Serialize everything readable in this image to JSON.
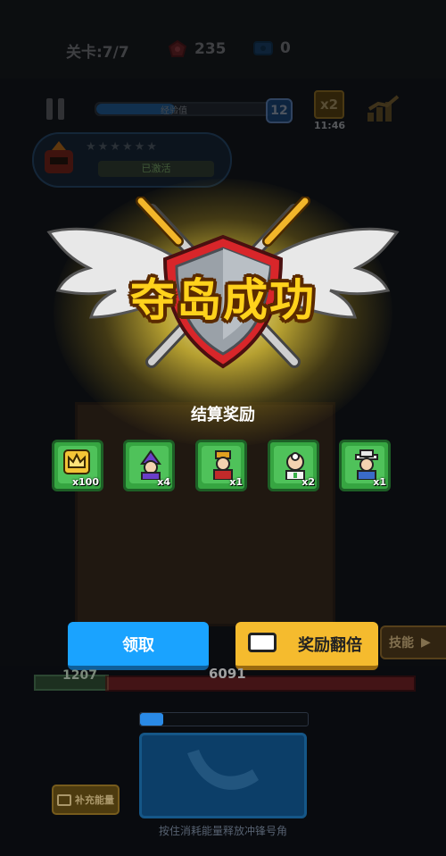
{
  "status_bar": {
    "level": "关卡:7/7",
    "gems": "235",
    "tickets": "0"
  },
  "hud": {
    "xp_label": "经验值",
    "xp_progress": 0.45,
    "player_level": "12",
    "multiplier": "x2",
    "multiplier_timer": "11:46",
    "hero_stars": "★★★★★★",
    "hero_status": "已激活"
  },
  "victory": {
    "title": "夺岛成功",
    "subtitle": "结算奖励"
  },
  "rewards": [
    {
      "icon": "crown-icon",
      "qty": "x100"
    },
    {
      "icon": "wizard-card-icon",
      "qty": "x4"
    },
    {
      "icon": "warrior-card-icon",
      "qty": "x1"
    },
    {
      "icon": "doctor-card-icon",
      "qty": "x2"
    },
    {
      "icon": "detective-card-icon",
      "qty": "x1"
    }
  ],
  "buttons": {
    "claim": "领取",
    "double": "奖励翻倍",
    "skill": "技能"
  },
  "battle": {
    "player_hp": "1207",
    "enemy_hp": "6091",
    "energy_progress": 0.14,
    "refill_label": "补充能量",
    "horn_caption": "按住消耗能量释放冲锋号角"
  },
  "colors": {
    "claim_button": "#1aa3ff",
    "double_button": "#f5bb2e",
    "title_gold": "#ffd21c",
    "reward_green": "#36a541"
  }
}
